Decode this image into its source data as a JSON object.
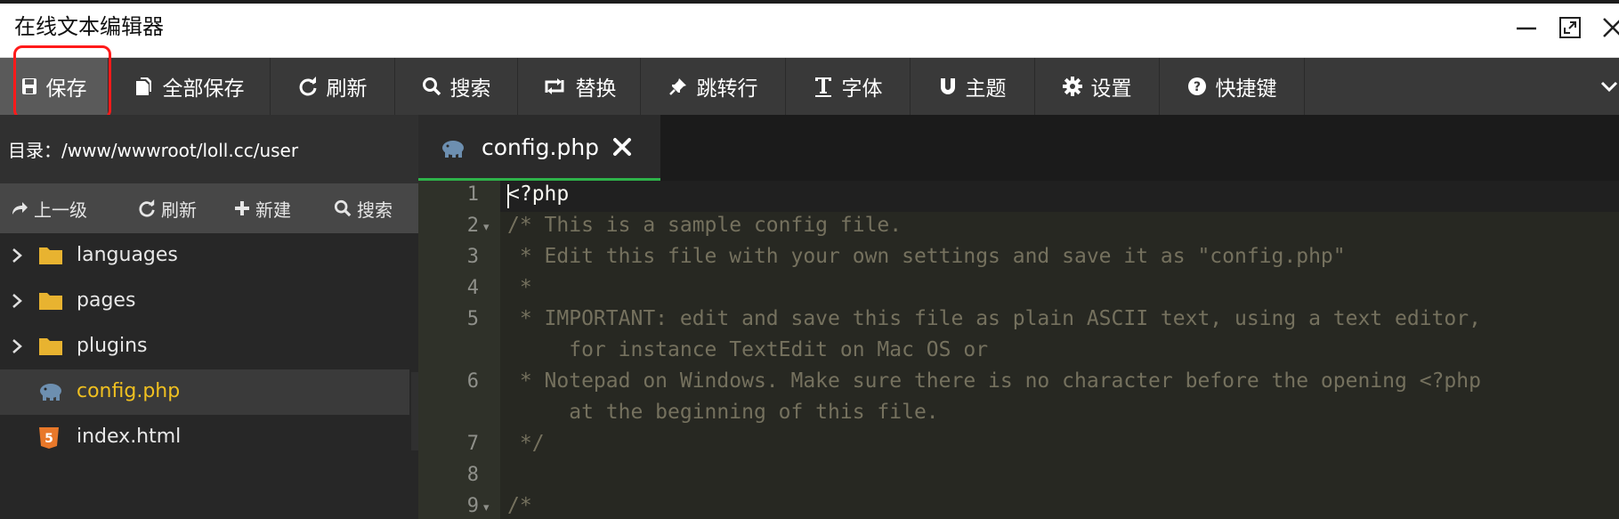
{
  "window": {
    "title": "在线文本编辑器",
    "controls": [
      "minimize-icon",
      "maximize-icon",
      "close-icon"
    ]
  },
  "toolbar": {
    "buttons": [
      {
        "label": "保存",
        "icon": "save-icon",
        "active": true
      },
      {
        "label": "全部保存",
        "icon": "save-all-icon"
      },
      {
        "label": "刷新",
        "icon": "refresh-icon"
      },
      {
        "label": "搜索",
        "icon": "search-icon"
      },
      {
        "label": "替换",
        "icon": "replace-icon"
      },
      {
        "label": "跳转行",
        "icon": "pin-icon"
      },
      {
        "label": "字体",
        "icon": "font-icon"
      },
      {
        "label": "主题",
        "icon": "magnet-icon"
      },
      {
        "label": "设置",
        "icon": "gear-icon"
      },
      {
        "label": "快捷键",
        "icon": "help-icon"
      }
    ]
  },
  "sidebar": {
    "dir_label": "目录：/www/wwwroot/loll.cc/user",
    "actions": [
      {
        "label": "上一级",
        "icon": "up-level-icon"
      },
      {
        "label": "刷新",
        "icon": "refresh-icon"
      },
      {
        "label": "新建",
        "icon": "plus-icon"
      },
      {
        "label": "搜索",
        "icon": "search-icon"
      }
    ],
    "items": [
      {
        "name": "languages",
        "type": "folder"
      },
      {
        "name": "pages",
        "type": "folder"
      },
      {
        "name": "plugins",
        "type": "folder"
      },
      {
        "name": "config.php",
        "type": "php",
        "selected": true
      },
      {
        "name": "index.html",
        "type": "html"
      }
    ]
  },
  "editor": {
    "tab": {
      "name": "config.php",
      "close": "✖"
    },
    "lines": [
      {
        "num": "1",
        "text": "<?php"
      },
      {
        "num": "2",
        "text": "/* This is a sample config file."
      },
      {
        "num": "3",
        "text": " * Edit this file with your own settings and save it as \"config.php\""
      },
      {
        "num": "4",
        "text": " *"
      },
      {
        "num": "5",
        "text": " * IMPORTANT: edit and save this file as plain ASCII text, using a text editor,"
      },
      {
        "num": "",
        "text": "     for instance TextEdit on Mac OS or"
      },
      {
        "num": "6",
        "text": " * Notepad on Windows. Make sure there is no character before the opening <?php"
      },
      {
        "num": "",
        "text": "     at the beginning of this file."
      },
      {
        "num": "7",
        "text": " */"
      },
      {
        "num": "8",
        "text": ""
      },
      {
        "num": "9",
        "text": "/*"
      }
    ]
  },
  "colors": {
    "toolbar_bg": "#393939",
    "highlight": "#ff1a1a",
    "tab_accent": "#2eb34a",
    "selected_file": "#f0c020"
  }
}
